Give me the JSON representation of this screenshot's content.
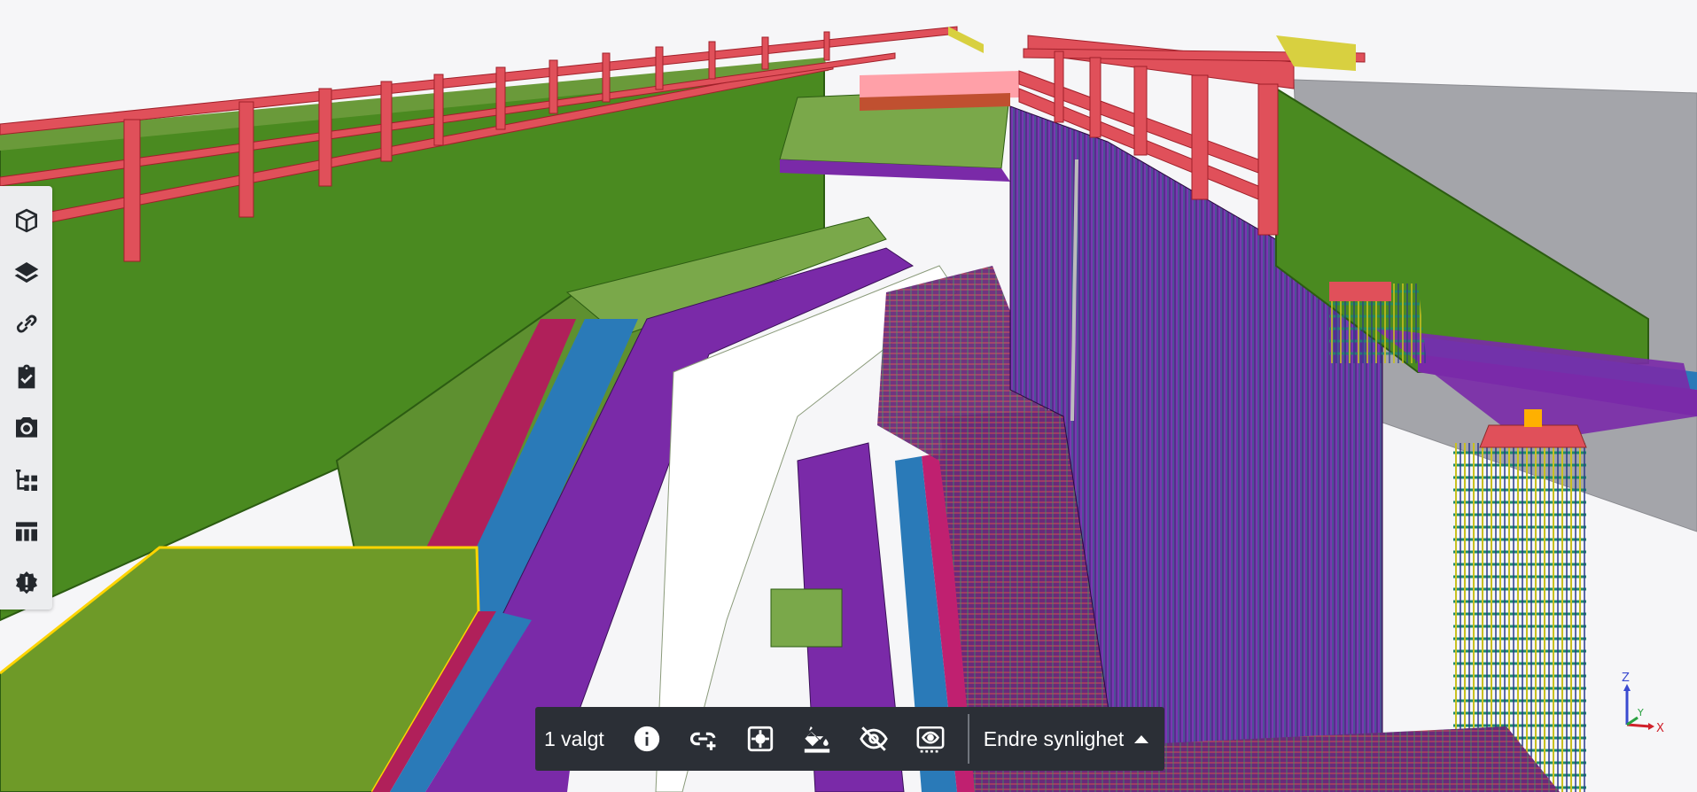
{
  "toolbar": {
    "items": [
      {
        "id": "models",
        "icon": "cube-icon"
      },
      {
        "id": "layers",
        "icon": "layers-icon"
      },
      {
        "id": "links",
        "icon": "link-icon"
      },
      {
        "id": "tasks",
        "icon": "clipboard-check-icon"
      },
      {
        "id": "snapshots",
        "icon": "camera-icon"
      },
      {
        "id": "tree",
        "icon": "tree-structure-icon"
      },
      {
        "id": "table",
        "icon": "table-icon"
      },
      {
        "id": "issues",
        "icon": "badge-alert-icon"
      }
    ]
  },
  "selection_bar": {
    "count_label": "1 valgt",
    "actions": [
      {
        "id": "info",
        "icon": "info-icon"
      },
      {
        "id": "link",
        "icon": "link-add-icon"
      },
      {
        "id": "fit",
        "icon": "fit-to-view-icon"
      },
      {
        "id": "color",
        "icon": "paint-bucket-icon"
      },
      {
        "id": "hide",
        "icon": "eye-off-icon"
      },
      {
        "id": "isolate",
        "icon": "isolate-view-icon"
      }
    ],
    "visibility_label": "Endre synlighet"
  },
  "axes": {
    "z": "Z",
    "y": "Y",
    "x": "X"
  },
  "colors": {
    "railing": "#e0505a",
    "concrete": "#4a8a20",
    "slab": "#7aa84a",
    "purple": "#7a2aa8",
    "blue": "#2a7ab8",
    "selection": "#ffd400",
    "gray_wall": "#a4a5aa"
  }
}
